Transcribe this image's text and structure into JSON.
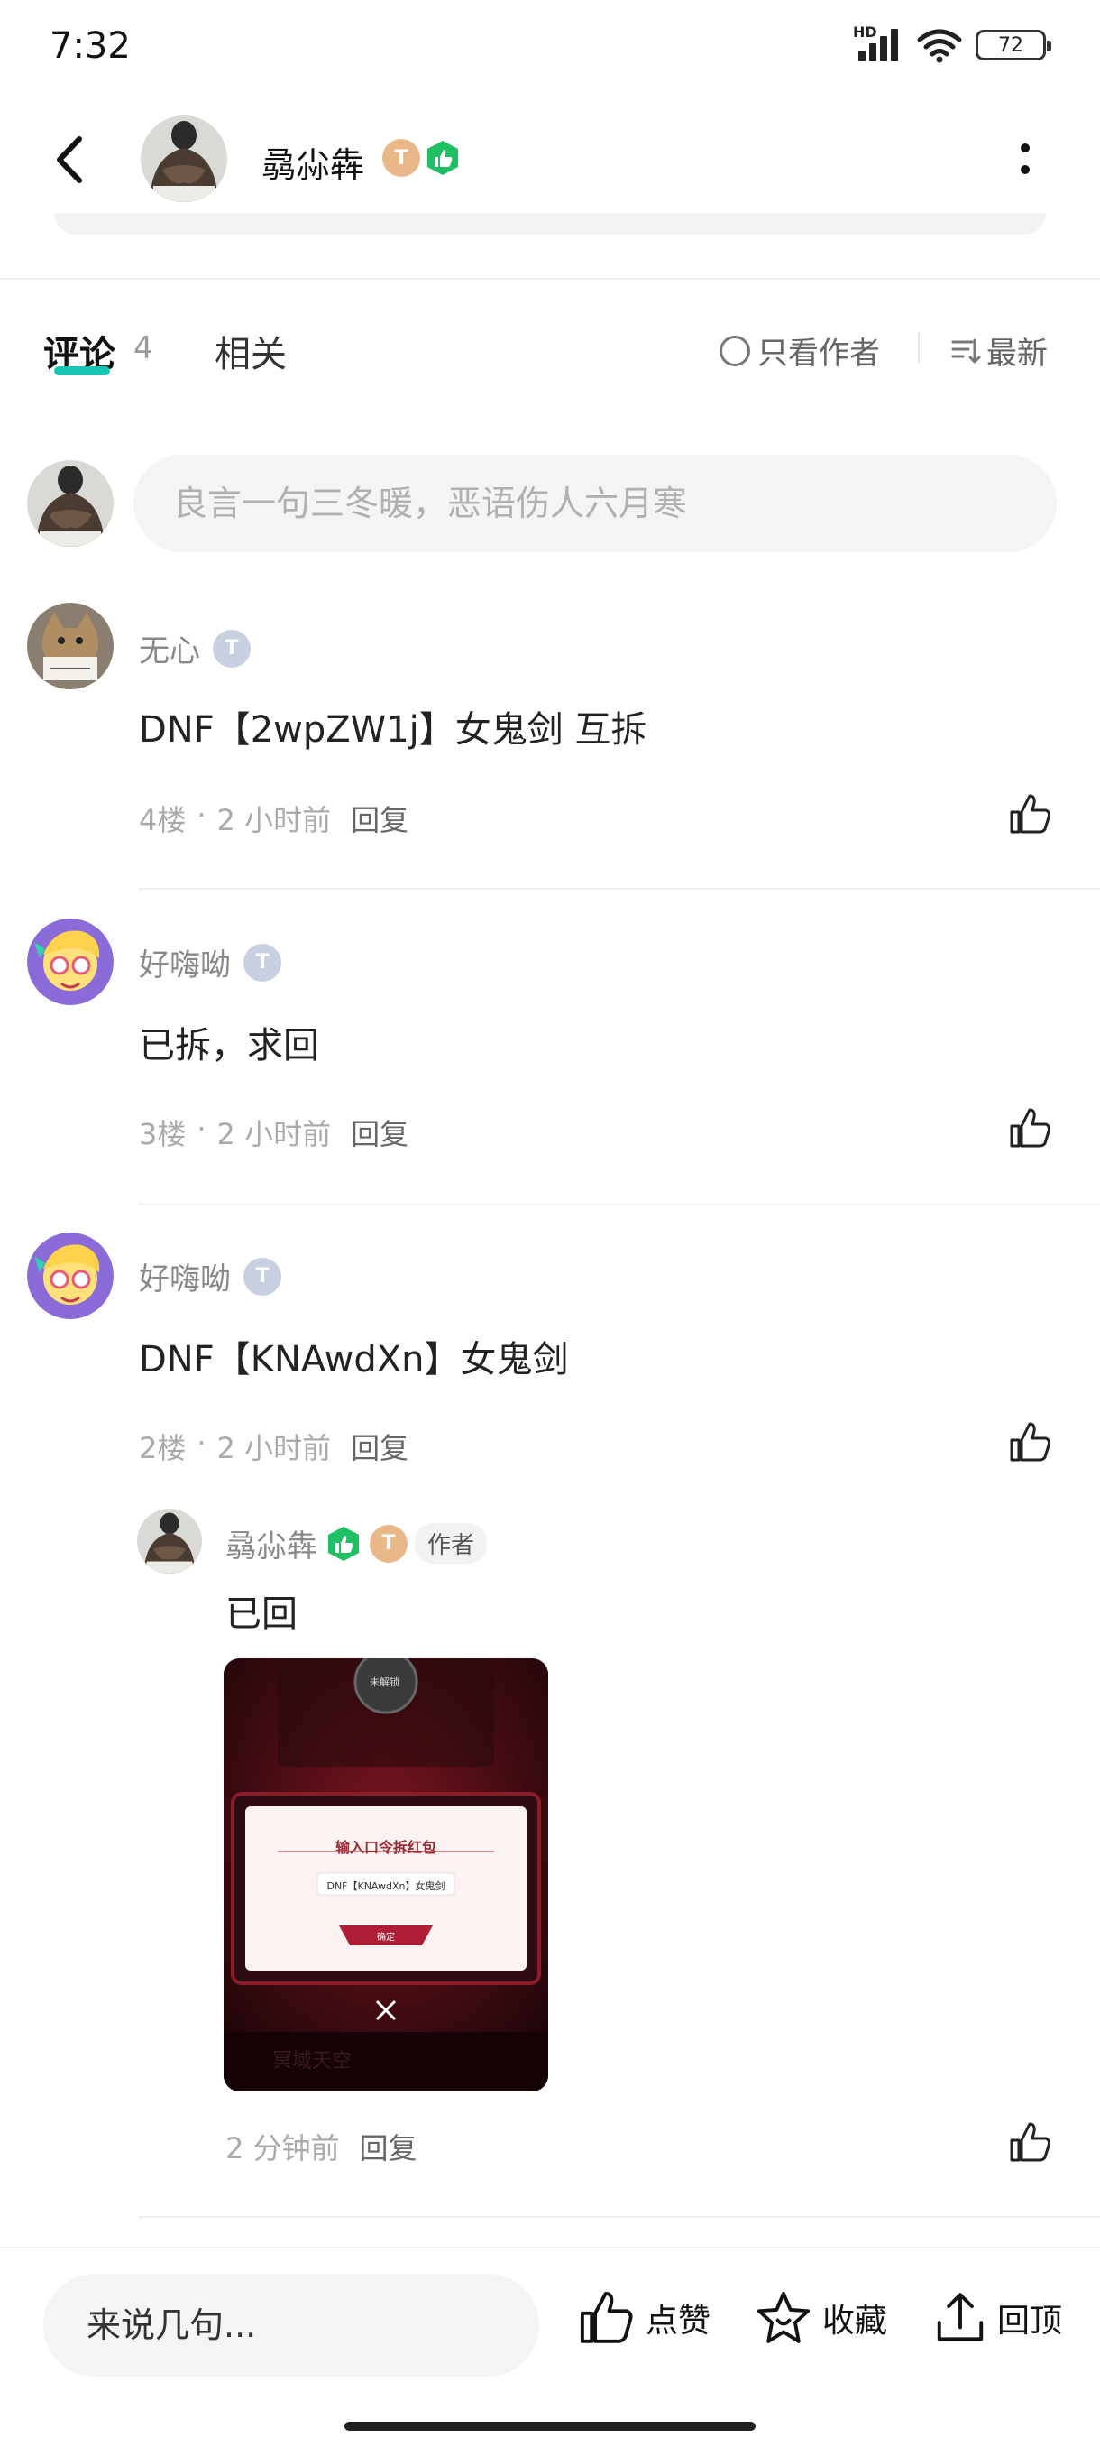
{
  "status_bar": {
    "time": "7:32",
    "network": "HD",
    "battery": "72"
  },
  "header": {
    "user_name": "骉尛犇",
    "badge_level": "T"
  },
  "tabs": {
    "comments_label": "评论",
    "comments_count": "4",
    "related_label": "相关",
    "filter_author": "只看作者",
    "sort": "最新"
  },
  "comment_input": {
    "placeholder": "良言一句三冬暖，恶语伤人六月寒"
  },
  "comments": [
    {
      "name": "无心",
      "badge": "T",
      "text": "DNF【2wpZW1j】女鬼剑 互拆",
      "floor": "4楼",
      "dot": "·",
      "time": "2 小时前",
      "reply": "回复"
    },
    {
      "name": "好嗨呦",
      "badge": "T",
      "text": "已拆，求回",
      "floor": "3楼",
      "dot": "·",
      "time": "2 小时前",
      "reply": "回复"
    },
    {
      "name": "好嗨呦",
      "badge": "T",
      "text": "DNF【KNAwdXn】女鬼剑",
      "floor": "2楼",
      "dot": "·",
      "time": "2 小时前",
      "reply": "回复"
    }
  ],
  "sub_reply": {
    "name": "骉尛犇",
    "author_tag": "作者",
    "text": "已回",
    "image": {
      "title": "输入口令拆红包",
      "code": "DNF【KNAwdXn】女鬼剑",
      "confirm": "确定",
      "stamp": "未解锁",
      "footer": "冥域天空"
    },
    "time": "2 分钟前",
    "reply": "回复"
  },
  "bottom_bar": {
    "input_placeholder": "来说几句...",
    "like": "点赞",
    "favorite": "收藏",
    "top": "回顶"
  },
  "colors": {
    "accent": "#17c5b6",
    "like_badge": "#1fbf63",
    "badge_gold": "#e8b888"
  }
}
